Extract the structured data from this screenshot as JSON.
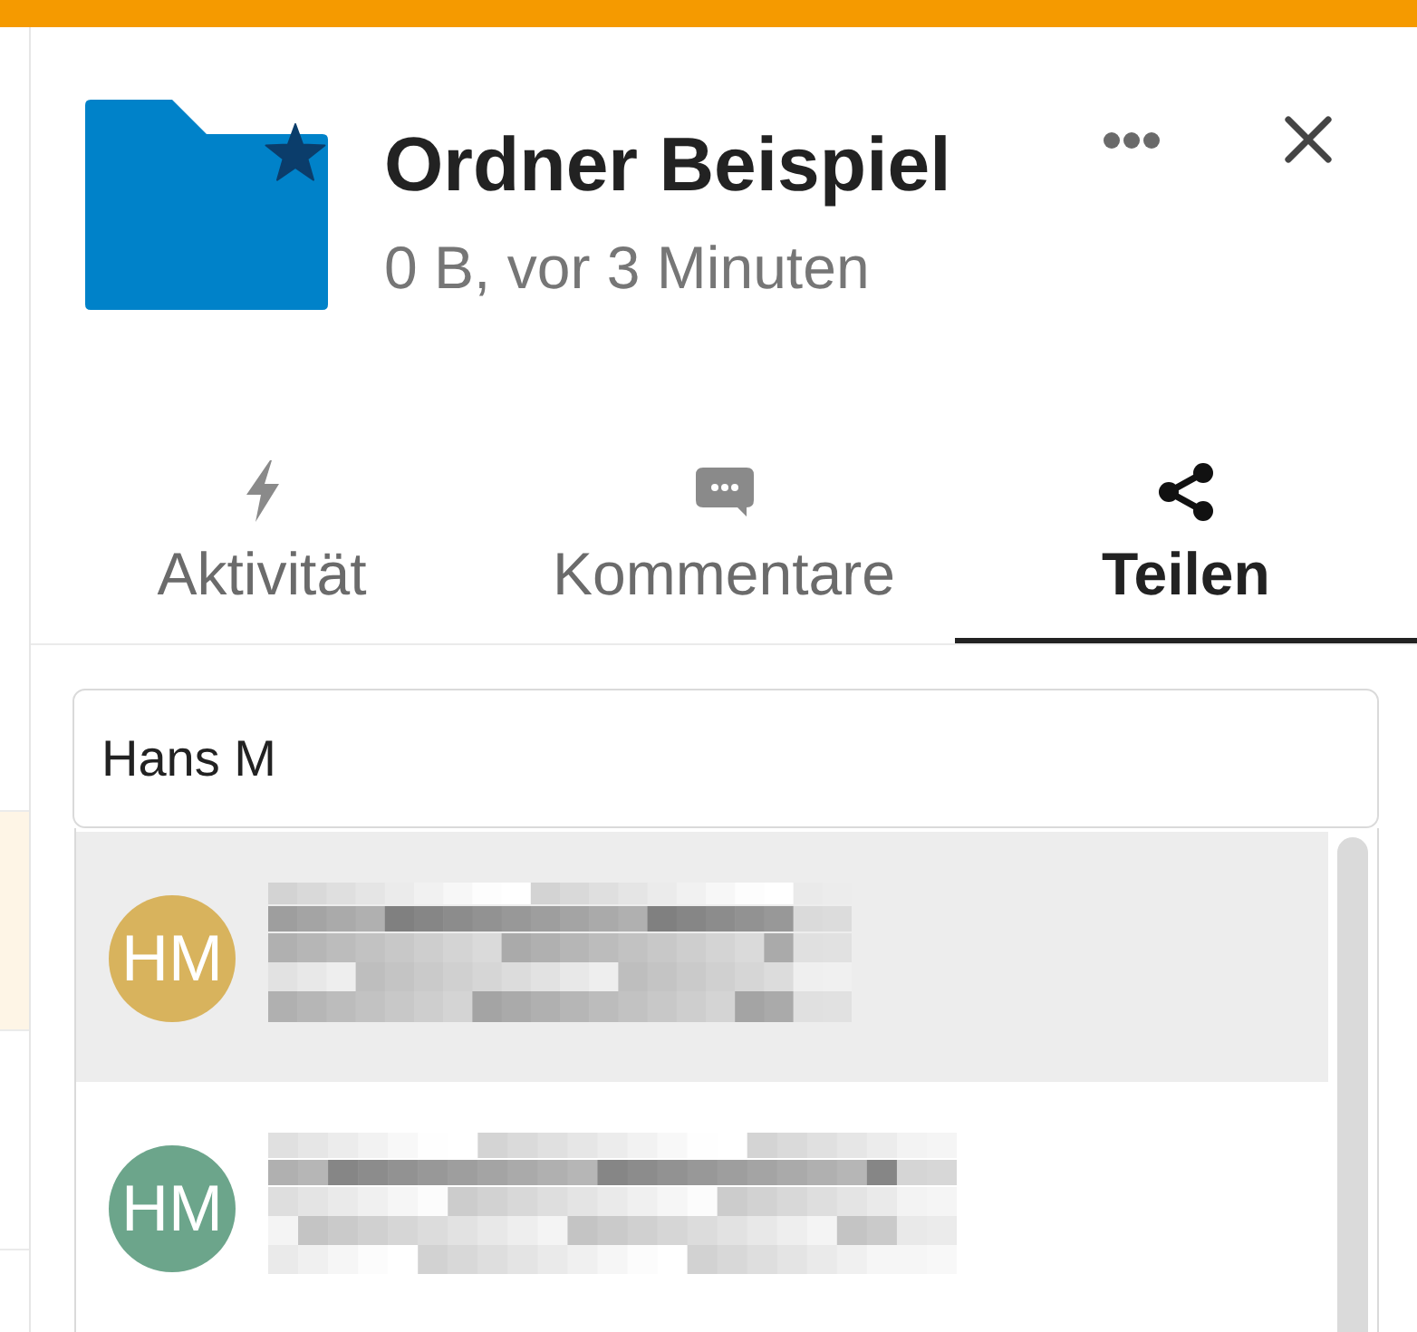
{
  "background_list": {
    "rows": [
      {
        "selected": true
      },
      {
        "selected": false
      },
      {
        "selected": false
      }
    ]
  },
  "sidebar": {
    "title": "Ordner Beispiel",
    "subtitle": "0 B, vor 3 Minuten",
    "favorite": true,
    "tabs": [
      {
        "kind": "activity",
        "label": "Aktivität",
        "selected": false
      },
      {
        "kind": "comments",
        "label": "Kommentare",
        "selected": false
      },
      {
        "kind": "share",
        "label": "Teilen",
        "selected": true
      }
    ],
    "share_search": {
      "value": "Hans M"
    },
    "suggestions": [
      {
        "initials": "HM",
        "color": "#d8b35d",
        "selected": true
      },
      {
        "initials": "HM",
        "color": "#6ca58b",
        "selected": false
      }
    ]
  }
}
